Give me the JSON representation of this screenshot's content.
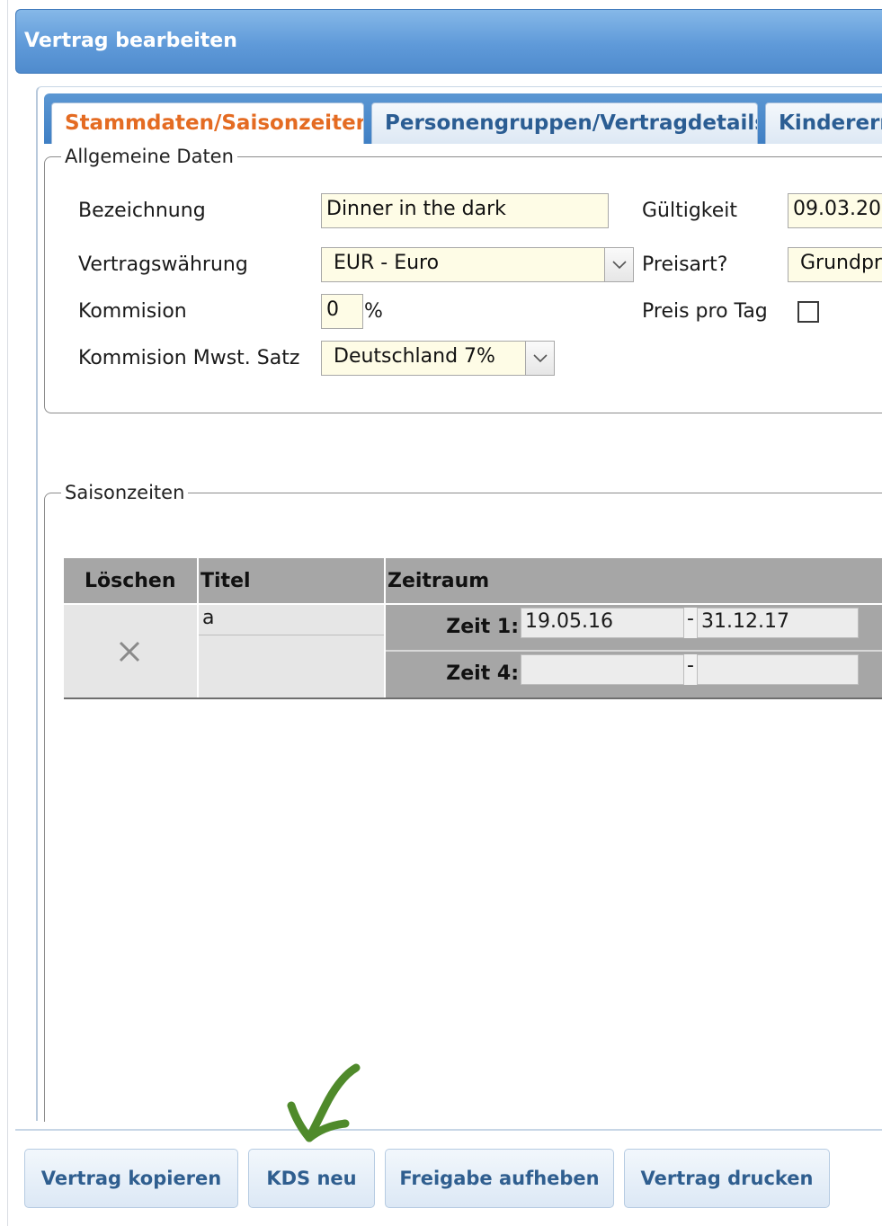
{
  "window": {
    "title": "Vertrag bearbeiten"
  },
  "tabs": [
    {
      "label": "Stammdaten/Saisonzeiten",
      "active": true
    },
    {
      "label": "Personengruppen/Vertragdetails",
      "active": false
    },
    {
      "label": "Kindererm",
      "active": false
    }
  ],
  "allgemeine_daten": {
    "legend": "Allgemeine Daten",
    "bezeichnung": {
      "label": "Bezeichnung",
      "value": "Dinner in the dark"
    },
    "vertragswaehrung": {
      "label": "Vertragswährung",
      "value": "EUR - Euro"
    },
    "kommision": {
      "label": "Kommision",
      "value": "0",
      "unit": "%"
    },
    "kommision_mwst": {
      "label": "Kommision Mwst. Satz",
      "value": "Deutschland 7%"
    },
    "gueltigkeit": {
      "label": "Gültigkeit",
      "value": "09.03.20"
    },
    "preisart": {
      "label": "Preisart?",
      "value": "Grundpr"
    },
    "preis_pro_tag": {
      "label": "Preis pro Tag",
      "checked": false
    }
  },
  "saisonzeiten": {
    "legend": "Saisonzeiten",
    "columns": {
      "loeschen": "Löschen",
      "titel": "Titel",
      "zeitraum": "Zeitraum"
    },
    "rows": [
      {
        "delete_icon": "close-icon",
        "titel": "a",
        "zeiten": [
          {
            "label": "Zeit 1:",
            "from": "19.05.16",
            "sep": "-",
            "to": "31.12.17"
          },
          {
            "label": "Zeit 4:",
            "from": "",
            "sep": "-",
            "to": ""
          }
        ]
      }
    ]
  },
  "footer": {
    "buttons": [
      "Vertrag kopieren",
      "KDS neu",
      "Freigabe aufheben",
      "Vertrag drucken"
    ]
  },
  "annotation": {
    "icon": "checkmark-annotation",
    "color": "#4f8a2b"
  },
  "colors": {
    "accent": "#e46b22",
    "header_blue": "#5f9ad9",
    "button_text": "#2f5e8f",
    "table_header": "#a6a6a6"
  }
}
